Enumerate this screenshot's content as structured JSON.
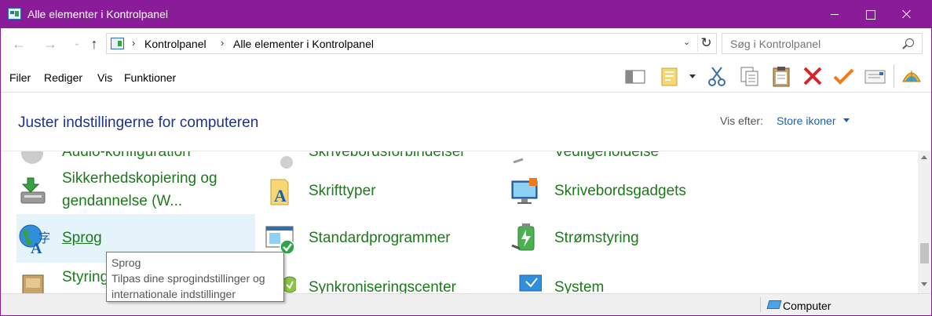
{
  "window": {
    "title": "Alle elementer i Kontrolpanel",
    "accent_color": "#8a1c9a"
  },
  "address": {
    "crumbs": [
      "Kontrolpanel",
      "Alle elementer i Kontrolpanel"
    ],
    "search_placeholder": "Søg i Kontrolpanel"
  },
  "menu": {
    "items": [
      "Filer",
      "Rediger",
      "Vis",
      "Funktioner"
    ]
  },
  "toolbar": {
    "icons": [
      "pane-icon",
      "folder-options-icon",
      "cut-icon",
      "copy-icon",
      "paste-icon",
      "delete-icon",
      "check-icon",
      "properties-icon",
      "shell-icon"
    ]
  },
  "header": {
    "title": "Juster indstillingerne for computeren",
    "view_by_label": "Vis efter:",
    "view_by_value": "Store ikoner"
  },
  "items": {
    "col1": [
      {
        "label": "Audio-konfiguration",
        "icon": "audio-icon"
      },
      {
        "label_line1": "Sikkerhedskopiering og",
        "label_line2": "gendannelse (W...",
        "icon": "backup-icon"
      },
      {
        "label": "Sprog",
        "icon": "language-icon"
      },
      {
        "label": "Styring",
        "icon": "credential-icon"
      }
    ],
    "col2": [
      {
        "label": "Skrivebordsforbindelser",
        "icon": "remote-desktop-icon"
      },
      {
        "label": "Skrifttyper",
        "icon": "fonts-icon"
      },
      {
        "label": "Standardprogrammer",
        "icon": "default-programs-icon"
      },
      {
        "label": "Synkroniseringscenter",
        "icon": "sync-center-icon"
      }
    ],
    "col3": [
      {
        "label": "Vedligeholdelse",
        "icon": "maintenance-icon"
      },
      {
        "label": "Skrivebordsgadgets",
        "icon": "gadgets-icon"
      },
      {
        "label": "Strømstyring",
        "icon": "power-icon"
      },
      {
        "label": "System",
        "icon": "system-icon"
      }
    ]
  },
  "tooltip": {
    "title": "Sprog",
    "line1": "Tilpas dine sprogindstillinger og",
    "line2": "internationale indstillinger"
  },
  "status": {
    "location": "Computer"
  },
  "colors": {
    "link_green": "#1b7a1b",
    "heading_blue": "#1e3287",
    "link_blue": "#1a5fb4",
    "hover_bg": "#e5f3fb"
  }
}
